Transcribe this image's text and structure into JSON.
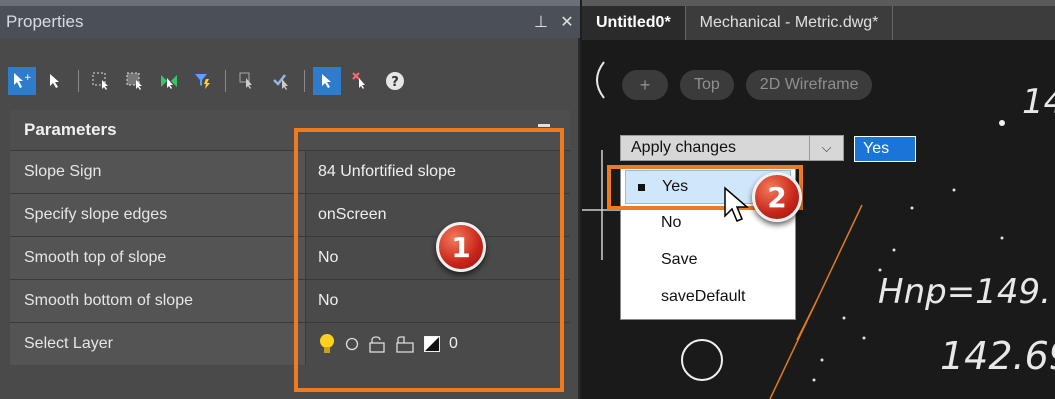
{
  "properties": {
    "title": "Properties",
    "section": "Parameters",
    "rows": [
      {
        "label": "Slope Sign",
        "value": "84 Unfortified slope"
      },
      {
        "label": "Specify slope edges",
        "value": "onScreen"
      },
      {
        "label": "Smooth top of slope",
        "value": "No"
      },
      {
        "label": "Smooth bottom of slope",
        "value": "No"
      },
      {
        "label": "Select Layer",
        "value": "0"
      }
    ]
  },
  "tabs": [
    "Untitled0*",
    "Mechanical - Metric.dwg*"
  ],
  "view_controls": [
    "+",
    "Top",
    "2D Wireframe"
  ],
  "prompt": {
    "label": "Apply changes",
    "current": "Yes",
    "options": [
      "Yes",
      "No",
      "Save",
      "saveDefault"
    ]
  },
  "callouts": [
    "1",
    "2"
  ],
  "drawing_text": [
    "14",
    "Hnp=149.",
    "142.69"
  ],
  "colors": {
    "highlight": "#f07b1e",
    "accent": "#1b74d8"
  }
}
